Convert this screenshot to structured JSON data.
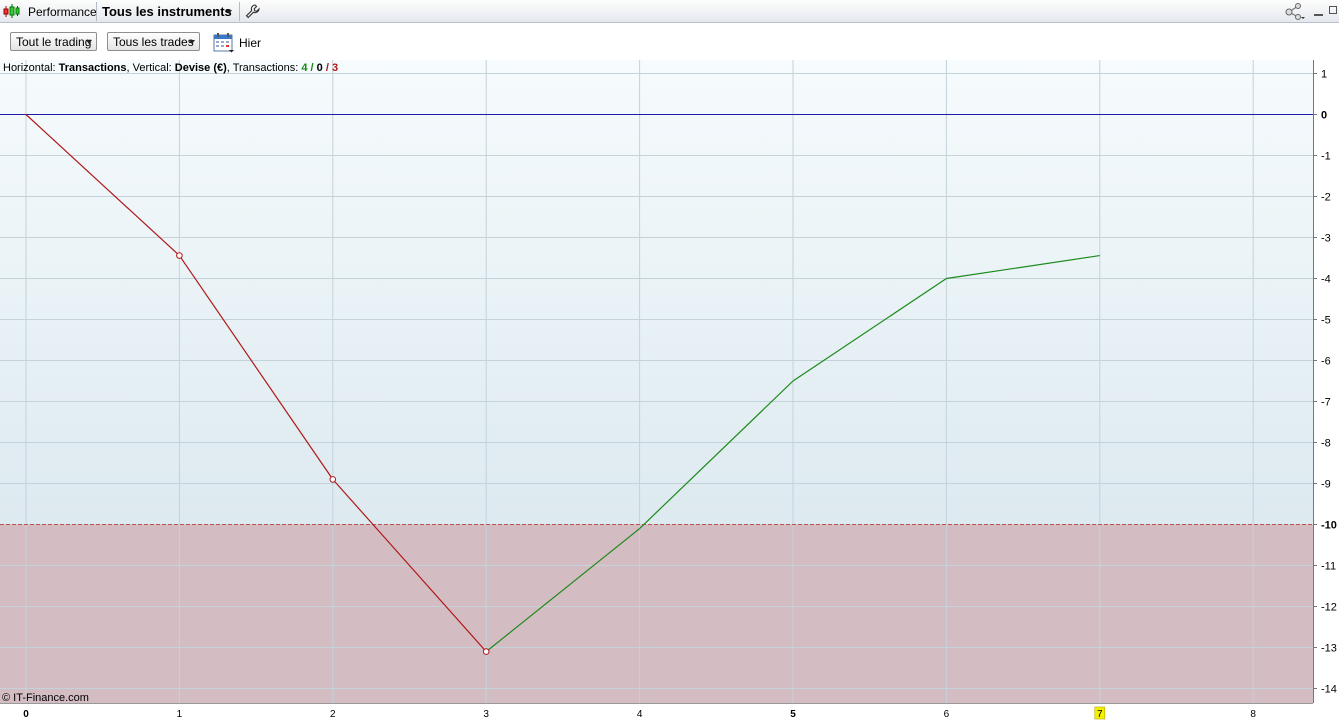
{
  "window": {
    "title": "Performance",
    "instrument": "Tous les instruments"
  },
  "toolbar": {
    "trading_select": "Tout le trading",
    "trades_select": "Tous les trades",
    "date_label": "Hier"
  },
  "header": {
    "horizontal_prefix": "Horizontal: ",
    "horizontal_value": "Transactions",
    "vertical_prefix": ", Vertical: ",
    "vertical_value": "Devise (€)",
    "transactions_prefix": ", Transactions: ",
    "tx_win": "4",
    "tx_sep1": " / ",
    "tx_neutral": "0",
    "tx_sep2": " / ",
    "tx_loss": "3"
  },
  "footer": {
    "copyright": "© IT-Finance.com"
  },
  "colors": {
    "loss": "#b01818",
    "gain": "#1a8a1a",
    "zero_line": "#1c1ca8",
    "threshold": "#c05050",
    "highlight": "#f5f000"
  },
  "chart_data": {
    "type": "line",
    "x": [
      0,
      1,
      2,
      3,
      4,
      5,
      6,
      7
    ],
    "y": [
      0,
      -3.44,
      -8.9,
      -13.1,
      -10.1,
      -6.5,
      -4.0,
      -3.44
    ],
    "segment_colors": [
      "loss",
      "loss",
      "loss",
      "gain",
      "gain",
      "gain",
      "gain"
    ],
    "marker_indices": [
      1,
      2,
      3
    ],
    "xlim": [
      -0.15,
      8.4
    ],
    "ylim": [
      -14.2,
      1.2
    ],
    "xticks": [
      0,
      1,
      2,
      3,
      4,
      5,
      6,
      7,
      8
    ],
    "bold_xticks": [
      0,
      5
    ],
    "highlighted_xtick": 7,
    "yticks": [
      1,
      0,
      -1,
      -2,
      -3,
      -4,
      -5,
      -6,
      -7,
      -8,
      -9,
      -10,
      -11,
      -12,
      -13,
      -14
    ],
    "bold_yticks": [
      0,
      -10
    ],
    "zero_line": 0,
    "threshold_line": -10,
    "grid": true,
    "axis_side": "right"
  }
}
